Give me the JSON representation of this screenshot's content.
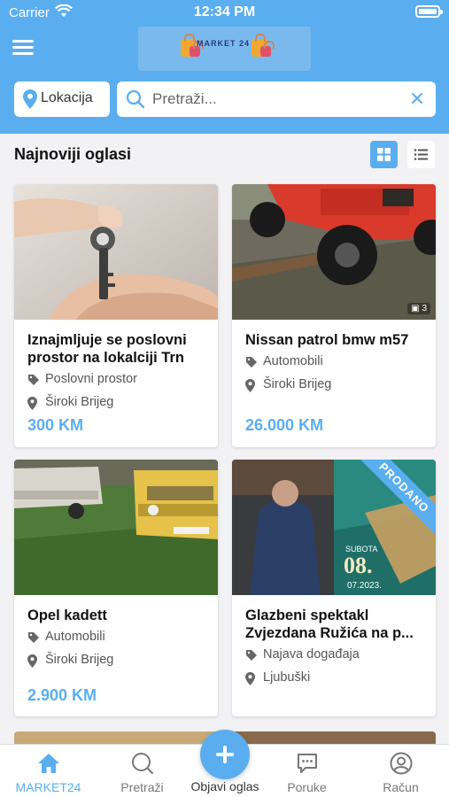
{
  "status_bar": {
    "carrier": "Carrier",
    "time": "12:34 PM"
  },
  "header": {
    "logo_text": "MARKET 24"
  },
  "location_button": {
    "label": "Lokacija"
  },
  "search": {
    "placeholder": "Pretraži..."
  },
  "section": {
    "title": "Najnoviji oglasi"
  },
  "listings": [
    {
      "title_line1": "Iznajmljuje se poslovni",
      "title_line2": "prostor na lokalciji Trn",
      "category": "Poslovni prostor",
      "location": "Široki Brijeg",
      "price": "300 KM"
    },
    {
      "title_line1": "Nissan patrol bmw m57",
      "title_line2": "",
      "category": "Automobili",
      "location": "Široki Brijeg",
      "price": "26.000 KM",
      "photo_count": "3"
    },
    {
      "title_line1": "Opel kadett",
      "title_line2": "",
      "category": "Automobili",
      "location": "Široki Brijeg",
      "price": "2.900 KM"
    },
    {
      "title_line1": "Glazbeni spektakl",
      "title_line2": "Zvjezdana Ružića na p...",
      "category": "Najava događaja",
      "location": "Ljubuški",
      "price": "",
      "ribbon": "PRODANO",
      "poster_day": "08.",
      "poster_date": "07.2023.",
      "poster_weekday": "SUBOTA"
    }
  ],
  "tabbar": {
    "home": "MARKET24",
    "search": "Pretraži",
    "post": "Objavi oglas",
    "messages": "Poruke",
    "account": "Račun"
  },
  "colors": {
    "accent": "#5aaef0",
    "background": "#f2f2f4"
  }
}
